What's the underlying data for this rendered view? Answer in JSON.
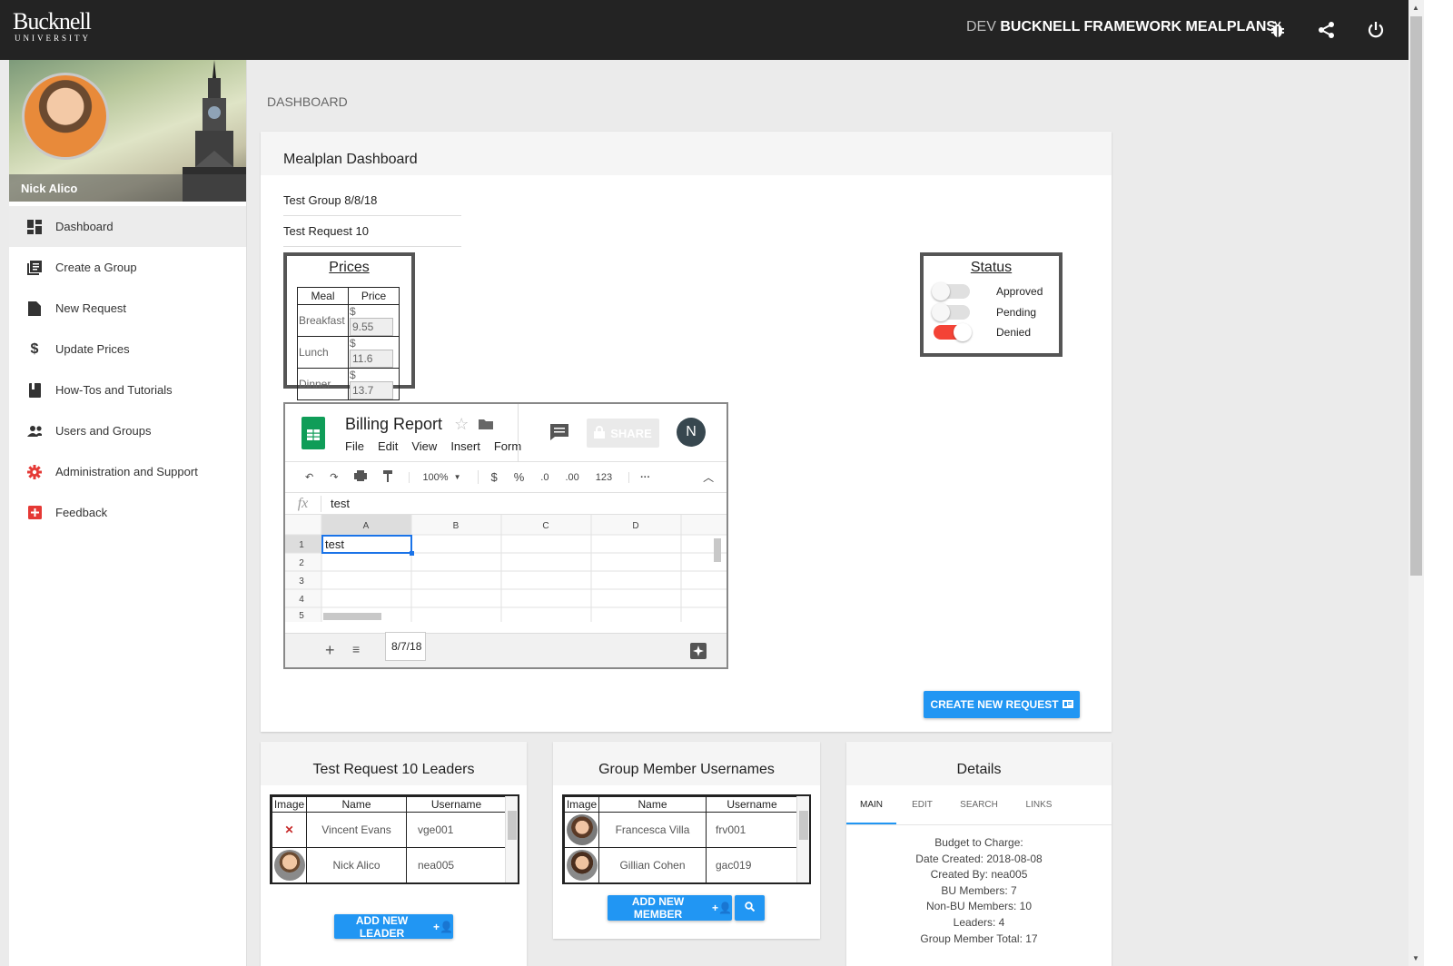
{
  "header": {
    "logo_line1": "Bucknell",
    "logo_line2": "UNIVERSITY",
    "env": "DEV",
    "app_name": "BUCKNELL FRAMEWORK MEALPLANS"
  },
  "sidebar": {
    "user_name": "Nick Alico",
    "items": [
      {
        "label": "Dashboard",
        "icon": "dashboard-icon"
      },
      {
        "label": "Create a Group",
        "icon": "library-icon"
      },
      {
        "label": "New Request",
        "icon": "file-icon"
      },
      {
        "label": "Update Prices",
        "icon": "dollar-icon"
      },
      {
        "label": "How-Tos and Tutorials",
        "icon": "book-icon"
      },
      {
        "label": "Users and Groups",
        "icon": "people-icon"
      },
      {
        "label": "Administration and Support",
        "icon": "gear-icon"
      },
      {
        "label": "Feedback",
        "icon": "plus-box-icon"
      }
    ]
  },
  "breadcrumb": "DASHBOARD",
  "main": {
    "title": "Mealplan Dashboard",
    "group": "Test Group 8/8/18",
    "request": "Test Request 10",
    "prices": {
      "title": "Prices",
      "headers": [
        "Meal",
        "Price"
      ],
      "rows": [
        {
          "meal": "Breakfast",
          "currency": "$",
          "price": "9.55"
        },
        {
          "meal": "Lunch",
          "currency": "$",
          "price": "11.6"
        },
        {
          "meal": "Dinner",
          "currency": "$",
          "price": "13.7"
        }
      ]
    },
    "status": {
      "title": "Status",
      "items": [
        {
          "label": "Approved",
          "on": false
        },
        {
          "label": "Pending",
          "on": false
        },
        {
          "label": "Denied",
          "on": true
        }
      ]
    },
    "sheet": {
      "title": "Billing Report",
      "menu": [
        "File",
        "Edit",
        "View",
        "Insert",
        "Form"
      ],
      "share": "SHARE",
      "avatar": "N",
      "toolbar": [
        "100%",
        "$",
        "%",
        ".0",
        ".00",
        "123"
      ],
      "formula_label": "fx",
      "formula_value": "test",
      "columns": [
        "A",
        "B",
        "C",
        "D"
      ],
      "rows": [
        "1",
        "2",
        "3",
        "4",
        "5"
      ],
      "cell_a1": "test",
      "tab": "8/7/18"
    },
    "create_button": "CREATE NEW REQUEST"
  },
  "leaders": {
    "title": "Test Request 10 Leaders",
    "headers": [
      "Image",
      "Name",
      "Username"
    ],
    "rows": [
      {
        "name": "Vincent Evans",
        "username": "vge001"
      },
      {
        "name": "Nick Alico",
        "username": "nea005"
      }
    ],
    "button": "ADD NEW LEADER"
  },
  "members": {
    "title": "Group Member Usernames",
    "headers": [
      "Image",
      "Name",
      "Username"
    ],
    "rows": [
      {
        "name": "Francesca Villa",
        "username": "frv001"
      },
      {
        "name": "Gillian Cohen",
        "username": "gac019"
      }
    ],
    "button": "ADD NEW MEMBER"
  },
  "details": {
    "title": "Details",
    "tabs": [
      "MAIN",
      "EDIT",
      "SEARCH",
      "LINKS"
    ],
    "lines": [
      "Budget to Charge:",
      "Date Created: 2018-08-08",
      "Created By: nea005",
      "BU Members: 7",
      "Non-BU Members: 10",
      "Leaders: 4",
      "Group Member Total: 17"
    ]
  },
  "colors": {
    "accent": "#2196f3",
    "topbar": "#232323",
    "toggle_on": "#f44336",
    "sheets_green": "#0f9d58"
  }
}
